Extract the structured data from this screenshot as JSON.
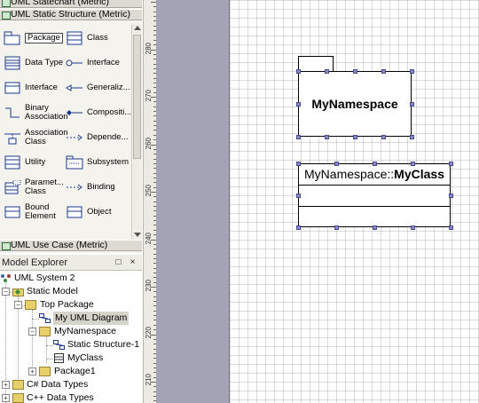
{
  "toolbox": {
    "groups": {
      "statechart": "UML Statechart (Metric)",
      "static_structure": "UML Static Structure (Metric)",
      "use_case": "UML Use Case (Metric)"
    },
    "tools": [
      {
        "label": "Package",
        "icon": "package-icon"
      },
      {
        "label": "Class",
        "icon": "class-icon"
      },
      {
        "label": "Data Type",
        "icon": "data-type-icon"
      },
      {
        "label": "Interface",
        "icon": "interface-lollipop-icon"
      },
      {
        "label": "Interface",
        "icon": "interface-icon"
      },
      {
        "label": "Generaliz...",
        "icon": "generalization-icon"
      },
      {
        "label": "Binary Association",
        "icon": "binary-association-icon"
      },
      {
        "label": "Compositi...",
        "icon": "composition-icon"
      },
      {
        "label": "Association Class",
        "icon": "association-class-icon"
      },
      {
        "label": "Depende...",
        "icon": "dependency-icon"
      },
      {
        "label": "Utility",
        "icon": "utility-icon"
      },
      {
        "label": "Subsystem",
        "icon": "subsystem-icon"
      },
      {
        "label": "Paramet... Class",
        "icon": "parameterized-class-icon"
      },
      {
        "label": "Binding",
        "icon": "binding-icon"
      },
      {
        "label": "Bound Element",
        "icon": "bound-element-icon"
      },
      {
        "label": "Object",
        "icon": "object-icon"
      }
    ]
  },
  "explorer": {
    "title": "Model Explorer",
    "pin": "□",
    "close": "×",
    "tree": [
      {
        "label": "UML System 2",
        "icon": "system-icon"
      },
      {
        "label": "Static Model",
        "icon": "model-icon"
      },
      {
        "label": "Top Package",
        "icon": "folder-icon"
      },
      {
        "label": "My UML Diagram",
        "icon": "diagram-icon"
      },
      {
        "label": "MyNamespace",
        "icon": "folder-icon"
      },
      {
        "label": "Static Structure-1",
        "icon": "diagram-icon"
      },
      {
        "label": "MyClass",
        "icon": "class-icon"
      },
      {
        "label": "Package1",
        "icon": "folder-icon"
      },
      {
        "label": "C# Data Types",
        "icon": "folder-icon"
      },
      {
        "label": "C++ Data Types",
        "icon": "folder-icon"
      }
    ]
  },
  "ruler": {
    "labels": [
      "280",
      "270",
      "260",
      "250",
      "240",
      "230",
      "220",
      "210"
    ]
  },
  "canvas": {
    "package_name": "MyNamespace",
    "class_namespace": "MyNamespace::",
    "class_name": "MyClass"
  }
}
